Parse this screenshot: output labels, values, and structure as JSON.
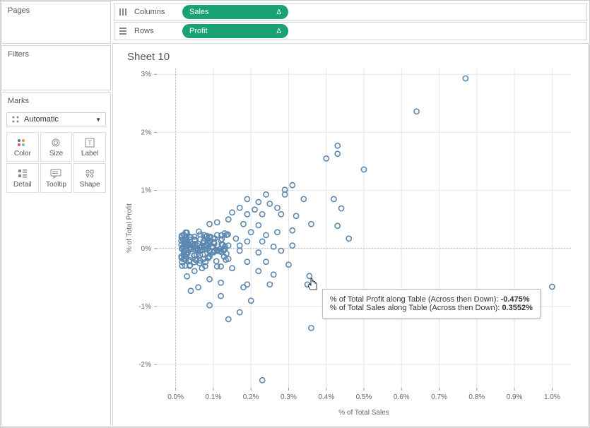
{
  "panels": {
    "pages": "Pages",
    "filters": "Filters",
    "marks": "Marks"
  },
  "marks_card": {
    "dropdown_label": "Automatic",
    "cells": [
      {
        "label": "Color",
        "name": "color"
      },
      {
        "label": "Size",
        "name": "size"
      },
      {
        "label": "Label",
        "name": "label"
      },
      {
        "label": "Detail",
        "name": "detail"
      },
      {
        "label": "Tooltip",
        "name": "tooltip"
      },
      {
        "label": "Shape",
        "name": "shape"
      }
    ]
  },
  "shelves": {
    "columns_label": "Columns",
    "rows_label": "Rows",
    "columns_pill": "Sales",
    "rows_pill": "Profit",
    "delta": "Δ"
  },
  "sheet_title": "Sheet 10",
  "tooltip": {
    "line1_label": "% of Total Profit along Table (Across then Down):",
    "line1_value": "-0.475%",
    "line2_label": "% of Total Sales along Table (Across then Down):",
    "line2_value": "0.3552%"
  },
  "chart_data": {
    "type": "scatter",
    "title": "Sheet 10",
    "xlabel": "% of Total Sales",
    "ylabel": "% of Total Profit",
    "xlim": [
      -0.05,
      1.05
    ],
    "ylim": [
      -2.4,
      3.1
    ],
    "x_ticks": [
      0.0,
      0.1,
      0.2,
      0.3,
      0.4,
      0.5,
      0.6,
      0.7,
      0.8,
      0.9,
      1.0
    ],
    "x_tick_labels": [
      "0.0%",
      "0.1%",
      "0.2%",
      "0.3%",
      "0.4%",
      "0.5%",
      "0.6%",
      "0.7%",
      "0.8%",
      "0.9%",
      "1.0%"
    ],
    "y_ticks": [
      -2,
      -1,
      0,
      1,
      2,
      3
    ],
    "y_tick_labels": [
      "-2%",
      "-1%",
      "0%",
      "1%",
      "2%",
      "3%"
    ],
    "highlight_point": {
      "x": 0.3552,
      "y": -0.475
    },
    "series": [
      {
        "name": "points",
        "values": [
          [
            0.77,
            2.93
          ],
          [
            0.64,
            2.36
          ],
          [
            0.43,
            1.63
          ],
          [
            0.43,
            1.77
          ],
          [
            0.4,
            1.55
          ],
          [
            0.5,
            1.36
          ],
          [
            0.31,
            1.09
          ],
          [
            0.29,
            1.01
          ],
          [
            0.29,
            0.93
          ],
          [
            0.34,
            0.85
          ],
          [
            0.42,
            0.85
          ],
          [
            0.44,
            0.69
          ],
          [
            0.24,
            0.93
          ],
          [
            0.19,
            0.85
          ],
          [
            0.22,
            0.8
          ],
          [
            0.25,
            0.77
          ],
          [
            0.27,
            0.7
          ],
          [
            0.21,
            0.67
          ],
          [
            0.17,
            0.7
          ],
          [
            0.15,
            0.62
          ],
          [
            0.19,
            0.59
          ],
          [
            0.23,
            0.59
          ],
          [
            0.28,
            0.59
          ],
          [
            0.32,
            0.56
          ],
          [
            0.14,
            0.5
          ],
          [
            0.11,
            0.45
          ],
          [
            0.09,
            0.42
          ],
          [
            0.18,
            0.42
          ],
          [
            0.22,
            0.4
          ],
          [
            0.36,
            0.42
          ],
          [
            0.43,
            0.39
          ],
          [
            0.31,
            0.31
          ],
          [
            0.27,
            0.28
          ],
          [
            0.2,
            0.28
          ],
          [
            0.24,
            0.23
          ],
          [
            0.13,
            0.26
          ],
          [
            0.11,
            0.23
          ],
          [
            0.08,
            0.2
          ],
          [
            0.16,
            0.17
          ],
          [
            0.46,
            0.17
          ],
          [
            0.12,
            0.14
          ],
          [
            0.05,
            0.14
          ],
          [
            0.19,
            0.12
          ],
          [
            0.23,
            0.12
          ],
          [
            0.09,
            0.1
          ],
          [
            0.06,
            0.08
          ],
          [
            0.03,
            0.06
          ],
          [
            0.14,
            0.05
          ],
          [
            0.17,
            0.05
          ],
          [
            0.26,
            0.03
          ],
          [
            0.31,
            0.05
          ],
          [
            0.1,
            0.02
          ],
          [
            0.04,
            0.02
          ],
          [
            0.02,
            0.03
          ],
          [
            0.07,
            -0.02
          ],
          [
            0.12,
            -0.04
          ],
          [
            0.17,
            -0.04
          ],
          [
            0.22,
            -0.07
          ],
          [
            0.28,
            -0.04
          ],
          [
            0.03,
            -0.1
          ],
          [
            0.05,
            -0.12
          ],
          [
            0.09,
            -0.14
          ],
          [
            0.14,
            -0.18
          ],
          [
            0.19,
            -0.23
          ],
          [
            0.24,
            -0.23
          ],
          [
            0.3,
            -0.28
          ],
          [
            0.11,
            -0.31
          ],
          [
            0.07,
            -0.34
          ],
          [
            0.05,
            -0.39
          ],
          [
            0.15,
            -0.34
          ],
          [
            0.22,
            -0.39
          ],
          [
            0.26,
            -0.45
          ],
          [
            0.03,
            -0.48
          ],
          [
            0.09,
            -0.53
          ],
          [
            0.12,
            -0.59
          ],
          [
            0.19,
            -0.62
          ],
          [
            0.06,
            -0.67
          ],
          [
            0.35,
            -0.62
          ],
          [
            0.25,
            -0.62
          ],
          [
            0.18,
            -0.67
          ],
          [
            1.0,
            -0.66
          ],
          [
            0.04,
            -0.73
          ],
          [
            0.12,
            -0.82
          ],
          [
            0.2,
            -0.9
          ],
          [
            0.09,
            -0.98
          ],
          [
            0.17,
            -1.1
          ],
          [
            0.14,
            -1.22
          ],
          [
            0.36,
            -1.37
          ],
          [
            0.23,
            -2.27
          ]
        ]
      }
    ],
    "cluster": {
      "x_range": [
        0.015,
        0.14
      ],
      "y_range": [
        -0.35,
        0.35
      ],
      "count": 120
    }
  }
}
